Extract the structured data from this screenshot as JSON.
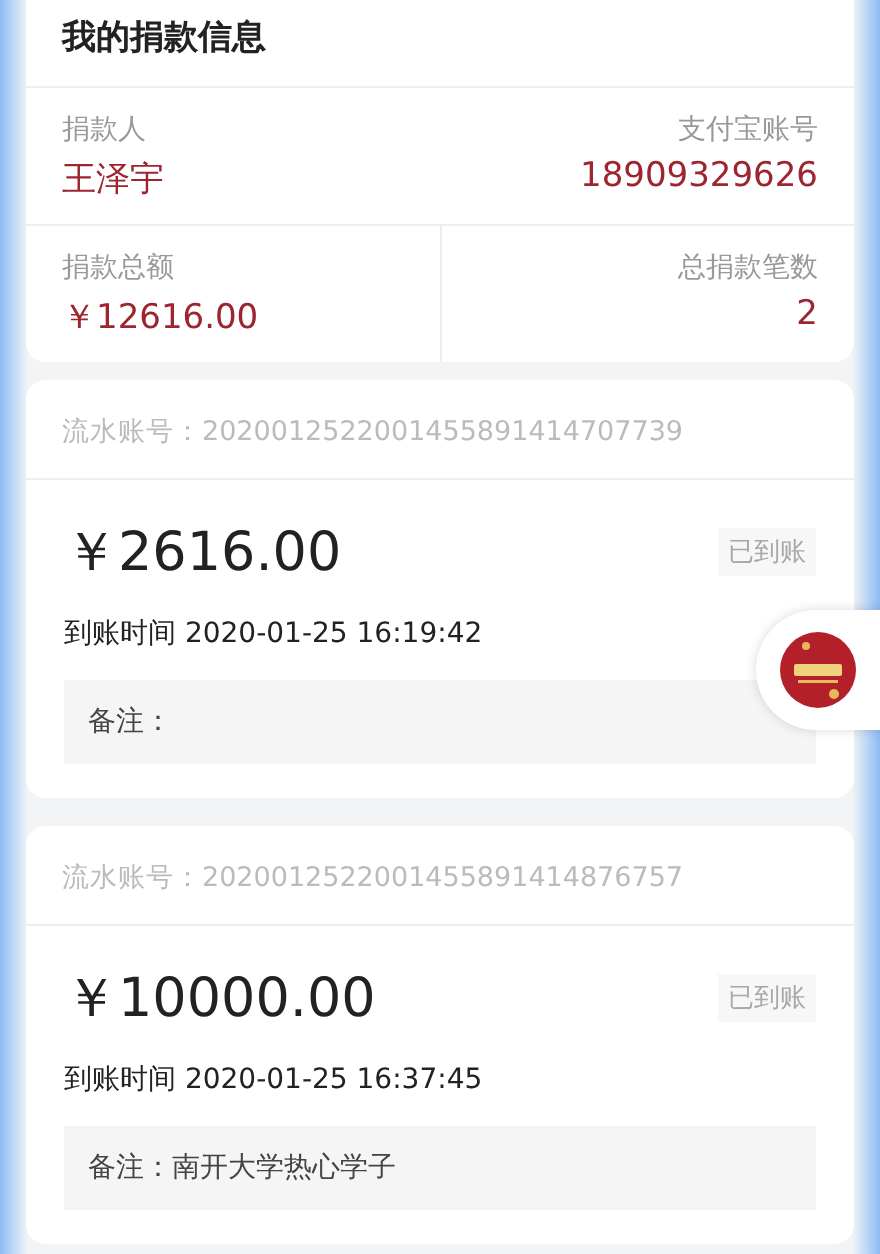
{
  "summary": {
    "title": "我的捐款信息",
    "fields": [
      {
        "label": "捐款人",
        "value": "王泽宇"
      },
      {
        "label": "支付宝账号",
        "value": "18909329626"
      },
      {
        "label": "捐款总额",
        "value": "￥12616.00"
      },
      {
        "label": "总捐款笔数",
        "value": "2"
      }
    ]
  },
  "records": [
    {
      "serial": "流水账号：2020012522001455891414707739",
      "amount": "￥2616.00",
      "status": "已到账",
      "time": "到账时间 2020-01-25 16:19:42",
      "note": "备注："
    },
    {
      "serial": "流水账号：2020012522001455891414876757",
      "amount": "￥10000.00",
      "status": "已到账",
      "time": "到账时间 2020-01-25 16:37:45",
      "note": "备注：南开大学热心学子"
    }
  ]
}
